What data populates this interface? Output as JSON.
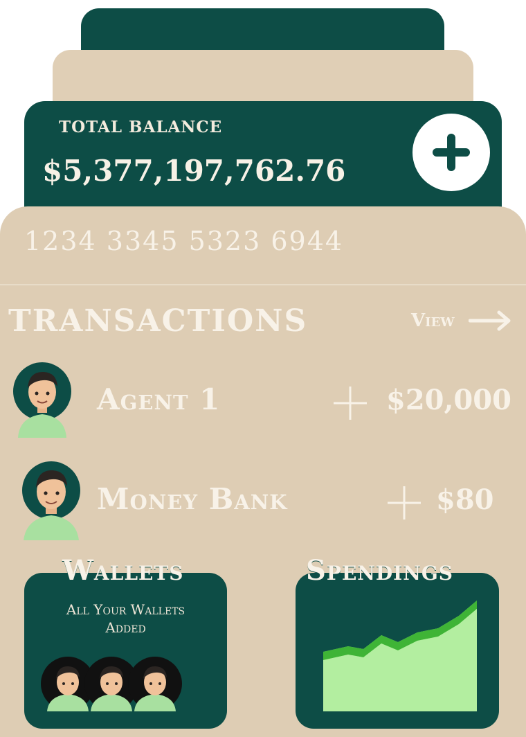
{
  "balance_card": {
    "label": "TOTAL BALANCE",
    "amount": "$5,377,197,762.76",
    "add_icon": "plus-icon"
  },
  "card_number": "1234 3345 5323 6944",
  "transactions": {
    "title": "TRANSACTIONS",
    "view_label": "View",
    "view_icon": "arrow-right-icon",
    "items": [
      {
        "name": "Agent 1",
        "amount": "$20,000",
        "sign_icon": "plus-icon",
        "avatar": "avatar-icon"
      },
      {
        "name": "Money Bank",
        "amount": "$80",
        "sign_icon": "plus-icon",
        "avatar": "avatar-icon"
      }
    ]
  },
  "wallets": {
    "title": "Wallets",
    "subtitle_line1": "All Your Wallets",
    "subtitle_line2": "Added",
    "avatar_count": 3
  },
  "spendings": {
    "title": "Spendings",
    "chart_icon": "area-chart-icon"
  },
  "colors": {
    "primary_green": "#0d4d46",
    "beige": "#decdb4",
    "cream_text": "#f8f2e8",
    "chart_green": "#7ee06a"
  }
}
